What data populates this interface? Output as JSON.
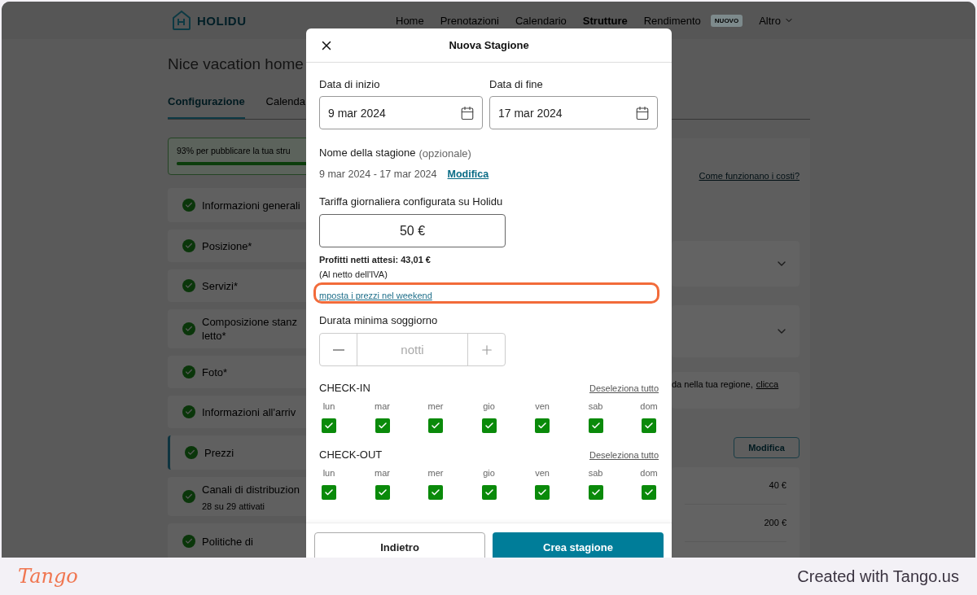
{
  "app_header": {
    "logo": "HOLIDU",
    "nav": [
      {
        "label": "Home",
        "selected": false
      },
      {
        "label": "Prenotazioni",
        "selected": false
      },
      {
        "label": "Calendario",
        "selected": false
      },
      {
        "label": "Strutture",
        "selected": true
      },
      {
        "label": "Rendimento",
        "selected": false,
        "badge": "NUOVO"
      },
      {
        "label": "Altro",
        "selected": false,
        "has_menu": true
      }
    ]
  },
  "page": {
    "title": "Nice vacation home",
    "tabs": [
      {
        "label": "Configurazione",
        "selected": true
      },
      {
        "label": "Calenda",
        "selected": false
      }
    ],
    "progress": {
      "text": "93% per pubblicare la tua stru",
      "level": 0.93
    },
    "sections": [
      {
        "label": "Informazioni generali",
        "done": true,
        "selected": false
      },
      {
        "label": "Posizione*",
        "done": true,
        "selected": false
      },
      {
        "label": "Servizi*",
        "done": true,
        "selected": false
      },
      {
        "label": "Composizione stanz letto*",
        "done": true,
        "selected": false
      },
      {
        "label": "Foto*",
        "done": true,
        "selected": false
      },
      {
        "label": "Informazioni all'arriv",
        "done": true,
        "selected": false
      },
      {
        "label": "Prezzi",
        "done": true,
        "selected": true
      },
      {
        "label": "Canali di distribuzion",
        "sublabel": "28 su 29 attivati",
        "done": true,
        "selected": false
      },
      {
        "label": "Politiche di",
        "done": true,
        "selected": false
      }
    ],
    "costs_link": "Come funzionano i costi?",
    "info_note": {
      "text": "da nella tua regione,",
      "link": "clicca"
    },
    "edit_button": "Modifica",
    "prices": [
      "40 €",
      "200 €"
    ]
  },
  "dialog": {
    "title": "Nuova Stagione",
    "start": {
      "label": "Data di inizio",
      "value": "9 mar 2024"
    },
    "end": {
      "label": "Data di fine",
      "value": "17 mar 2024"
    },
    "season_name": {
      "label": "Nome della stagione",
      "hint": "(opzionale)",
      "value": "9 mar 2024 - 17 mar 2024",
      "link": "Modifica"
    },
    "rate": {
      "label": "Tariffa giornaliera configurata su Holidu",
      "value": "50 €",
      "profit": "Profitti netti attesi: 43,01 €",
      "note": "(Al netto dell'IVA)",
      "weekend_link": "mposta i prezzi nel weekend"
    },
    "min_stay": {
      "label": "Durata minima soggiorno",
      "placeholder": "notti"
    },
    "day_groups": [
      {
        "title": "CHECK-IN",
        "deselect": "Deseleziona tutto",
        "days": [
          {
            "label": "lun",
            "checked": true
          },
          {
            "label": "mar",
            "checked": true
          },
          {
            "label": "mer",
            "checked": true
          },
          {
            "label": "gio",
            "checked": true
          },
          {
            "label": "ven",
            "checked": true
          },
          {
            "label": "sab",
            "checked": true
          },
          {
            "label": "dom",
            "checked": true
          }
        ]
      },
      {
        "title": "CHECK-OUT",
        "deselect": "Deseleziona tutto",
        "days": [
          {
            "label": "lun",
            "checked": true
          },
          {
            "label": "mar",
            "checked": true
          },
          {
            "label": "mer",
            "checked": true
          },
          {
            "label": "gio",
            "checked": true
          },
          {
            "label": "ven",
            "checked": true
          },
          {
            "label": "sab",
            "checked": true
          },
          {
            "label": "dom",
            "checked": true
          }
        ]
      }
    ],
    "back_button": "Indietro",
    "create_button": "Crea stagione"
  },
  "footer": {
    "logo": "Tango",
    "caption": "Created with Tango.us"
  }
}
